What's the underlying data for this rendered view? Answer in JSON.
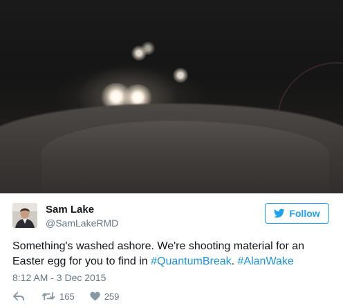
{
  "media": {
    "icon": "photo"
  },
  "author": {
    "name": "Sam Lake",
    "handle": "@SamLakeRMD"
  },
  "follow": {
    "label": "Follow",
    "icon": "bird-icon",
    "color": "#1da1f2"
  },
  "tweet": {
    "text_before": "Something's washed ashore. We're shooting material for an Easter egg for you to find in ",
    "hashtag1": "#QuantumBreak",
    "separator": ". ",
    "hashtag2": "#AlanWake",
    "hashtag_color": "#1b95e0",
    "timestamp": "8:12 AM - 3 Dec 2015"
  },
  "actions": {
    "reply_icon": "reply-icon",
    "retweet_icon": "retweet-icon",
    "retweets": "165",
    "like_icon": "heart-icon",
    "likes": "259"
  }
}
